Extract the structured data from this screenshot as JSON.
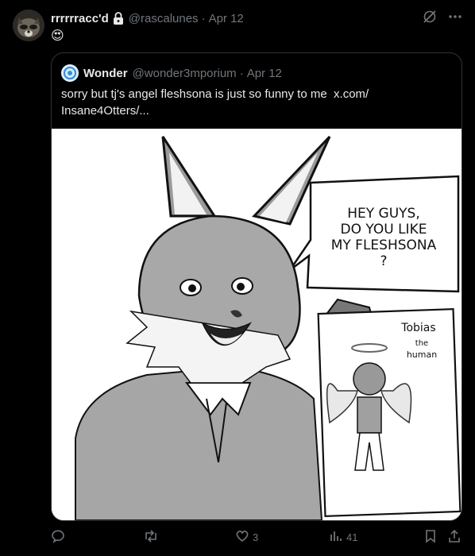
{
  "post": {
    "display_name": "rrrrrracc'd",
    "handle": "@rascalunes",
    "separator": "·",
    "date": "Apr 12",
    "emoji": "😍"
  },
  "quote": {
    "display_name": "Wonder",
    "handle": "@wonder3mporium",
    "separator": "·",
    "date": "Apr 12",
    "text": "sorry but tj's angel fleshsona is just so funny to me",
    "link": "x.com/Insane4Otters/...",
    "link_line1": "x.com/",
    "link_line2": "Insane4Otters/..."
  },
  "artwork": {
    "speech_bubble": [
      "HEY GUYS,",
      "DO YOU LIKE",
      "MY FLESHSONA",
      "?"
    ],
    "sign_name": "Tobias",
    "sign_the": "the",
    "sign_human": "human"
  },
  "actions": {
    "reply_count": "",
    "repost_count": "",
    "like_count": "3",
    "views_count": "41"
  }
}
